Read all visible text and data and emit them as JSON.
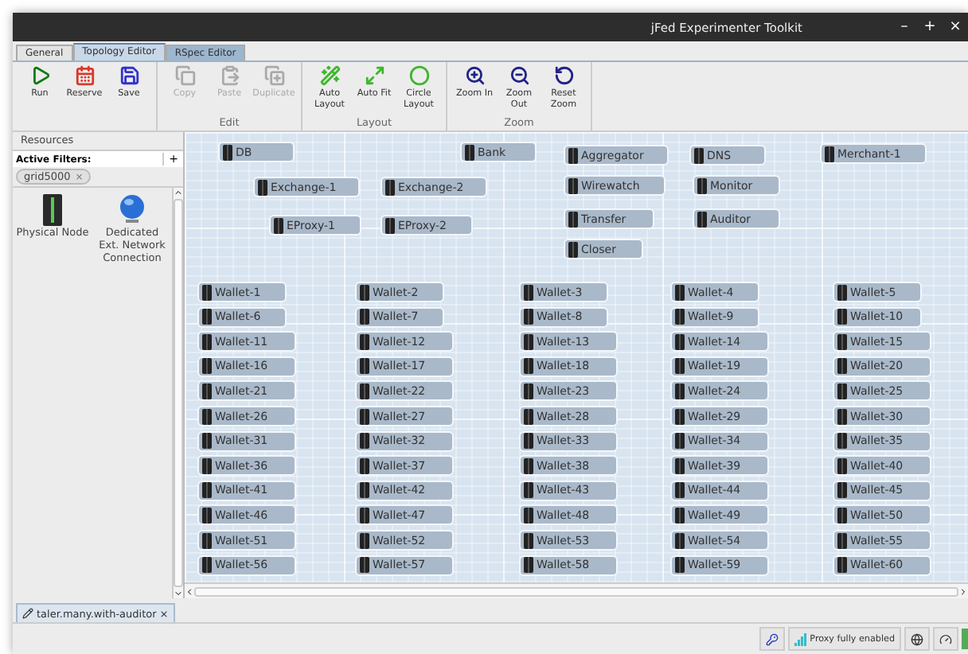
{
  "window": {
    "title": "jFed Experimenter Toolkit",
    "controls": [
      "–",
      "+",
      "×"
    ]
  },
  "tabs": [
    {
      "label": "General",
      "selected": false
    },
    {
      "label": "Topology Editor",
      "selected": true
    },
    {
      "label": "RSpec Editor",
      "selected": false
    }
  ],
  "toolbar": [
    {
      "buttons": [
        {
          "kind": "run",
          "label": "Run",
          "disabled": false
        },
        {
          "kind": "reserve",
          "label": "Reserve",
          "disabled": false
        },
        {
          "kind": "save",
          "label": "Save",
          "disabled": false
        }
      ]
    },
    {
      "group": "Edit",
      "buttons": [
        {
          "kind": "copy",
          "label": "Copy",
          "disabled": true
        },
        {
          "kind": "paste",
          "label": "Paste",
          "disabled": true
        },
        {
          "kind": "duplicate",
          "label": "Duplicate",
          "disabled": true
        }
      ]
    },
    {
      "group": "Layout",
      "buttons": [
        {
          "kind": "auto-layout",
          "label": "Auto Layout",
          "disabled": false
        },
        {
          "kind": "auto-fit",
          "label": "Auto Fit",
          "disabled": false
        },
        {
          "kind": "circle",
          "label": "Circle Layout",
          "disabled": false
        }
      ]
    },
    {
      "group": "Zoom",
      "buttons": [
        {
          "kind": "zoom-in",
          "label": "Zoom In",
          "disabled": false
        },
        {
          "kind": "zoom-out",
          "label": "Zoom Out",
          "disabled": false
        },
        {
          "kind": "reset",
          "label": "Reset Zoom",
          "disabled": false
        }
      ]
    }
  ],
  "resources": {
    "title": "Resources",
    "filters_label": "Active Filters:",
    "add": "+",
    "filters": [
      {
        "label": "grid5000",
        "remove": "×"
      }
    ],
    "items": [
      {
        "kind": "node",
        "label": "Physical Node"
      },
      {
        "kind": "network",
        "label": "Dedicated Ext. Network Connection"
      }
    ]
  },
  "nodes": [
    {
      "label": "DB"
    },
    {
      "label": "Bank"
    },
    {
      "label": "Aggregator"
    },
    {
      "label": "DNS"
    },
    {
      "label": "Merchant-1"
    },
    {
      "label": "Exchange-1"
    },
    {
      "label": "Exchange-2"
    },
    {
      "label": "Wirewatch"
    },
    {
      "label": "Monitor"
    },
    {
      "label": "EProxy-1"
    },
    {
      "label": "EProxy-2"
    },
    {
      "label": "Transfer"
    },
    {
      "label": "Auditor"
    },
    {
      "label": "Closer"
    }
  ],
  "wallets": [
    "Wallet-1",
    "Wallet-2",
    "Wallet-3",
    "Wallet-4",
    "Wallet-5",
    "Wallet-6",
    "Wallet-7",
    "Wallet-8",
    "Wallet-9",
    "Wallet-10",
    "Wallet-11",
    "Wallet-12",
    "Wallet-13",
    "Wallet-14",
    "Wallet-15",
    "Wallet-16",
    "Wallet-17",
    "Wallet-18",
    "Wallet-19",
    "Wallet-20",
    "Wallet-21",
    "Wallet-22",
    "Wallet-23",
    "Wallet-24",
    "Wallet-25",
    "Wallet-26",
    "Wallet-27",
    "Wallet-28",
    "Wallet-29",
    "Wallet-30",
    "Wallet-31",
    "Wallet-32",
    "Wallet-33",
    "Wallet-34",
    "Wallet-35",
    "Wallet-36",
    "Wallet-37",
    "Wallet-38",
    "Wallet-39",
    "Wallet-40",
    "Wallet-41",
    "Wallet-42",
    "Wallet-43",
    "Wallet-44",
    "Wallet-45",
    "Wallet-46",
    "Wallet-47",
    "Wallet-48",
    "Wallet-49",
    "Wallet-50",
    "Wallet-51",
    "Wallet-52",
    "Wallet-53",
    "Wallet-54",
    "Wallet-55",
    "Wallet-56",
    "Wallet-57",
    "Wallet-58",
    "Wallet-59",
    "Wallet-60"
  ],
  "documents": [
    {
      "label": "taler.many.with-auditor",
      "close": "×"
    }
  ],
  "status_bar": {
    "proxy": "Proxy fully enabled"
  }
}
